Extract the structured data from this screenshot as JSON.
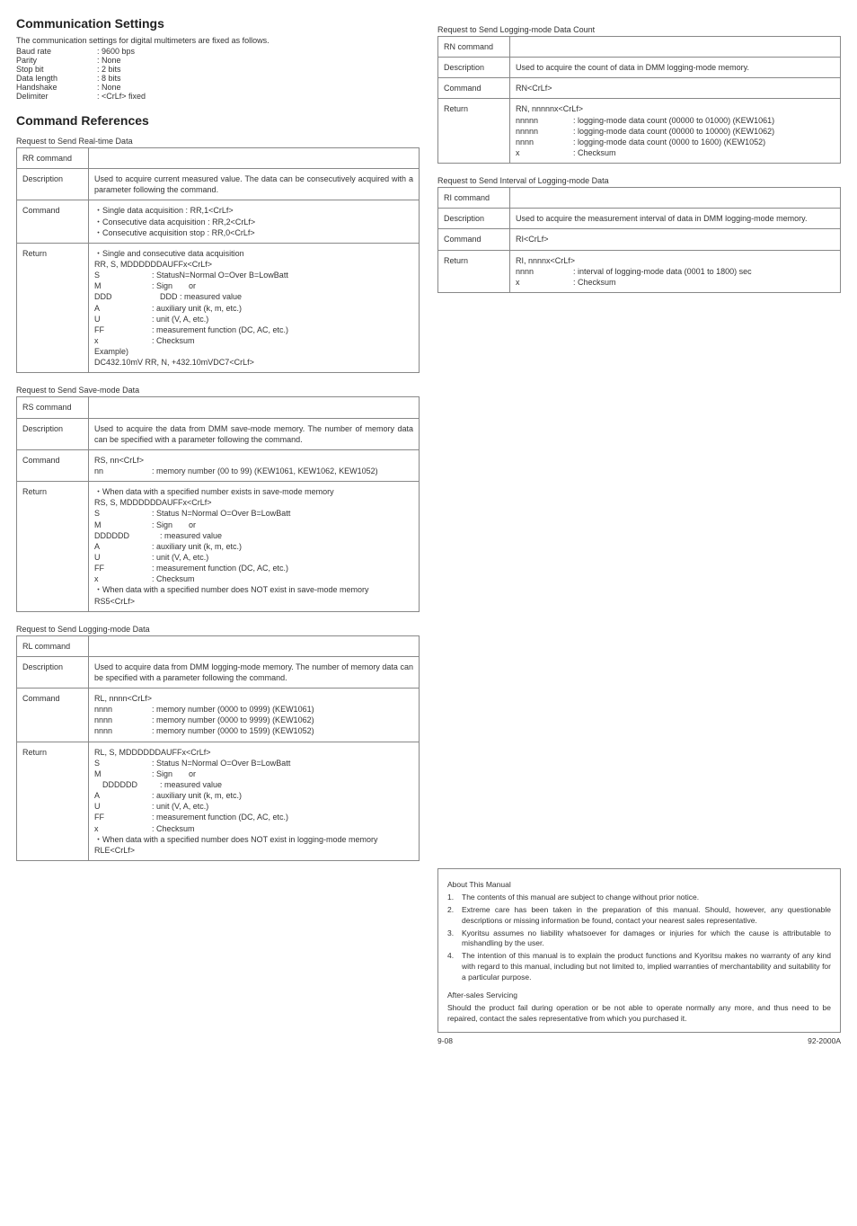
{
  "left": {
    "commSettings": {
      "heading": "Communication Settings",
      "intro": "The communication settings for digital multimeters are fixed as follows.",
      "rows": [
        {
          "k": "Baud rate",
          "v": ": 9600 bps"
        },
        {
          "k": "Parity",
          "v": ": None"
        },
        {
          "k": "Stop bit",
          "v": ": 2 bits"
        },
        {
          "k": "Data length",
          "v": ": 8 bits"
        },
        {
          "k": "Handshake",
          "v": ": None"
        },
        {
          "k": "Delimiter",
          "v": ": <CrLf> fixed"
        }
      ]
    },
    "commandRefs": {
      "heading": "Command References",
      "tables": [
        {
          "title": "Request to Send Real-time Data",
          "cmdName": "RR command",
          "rows": [
            {
              "label": "Description",
              "lines": [
                "Used to acquire current measured value. The data can be consecutively acquired with a parameter following the command."
              ],
              "justify": true
            },
            {
              "label": "Command",
              "lines": [
                "・Single data acquisition : RR,1<CrLf>",
                "・Consecutive data acquisition : RR,2<CrLf>",
                "・Consecutive acquisition stop : RR,0<CrLf>"
              ]
            },
            {
              "label": "Return",
              "lines": [
                "・Single and consecutive data acquisition",
                "RR, S, MDDDDDDAUFFx<CrLf>"
              ],
              "defs": [
                {
                  "k": "S",
                  "v": ": StatusN=Normal O=Over B=LowBatt"
                },
                {
                  "k": "M",
                  "v": ": Sign　　or"
                },
                {
                  "k": "DDD",
                  "v": "　DDD : measured value"
                },
                {
                  "k": "A",
                  "v": ": auxiliary unit (k, m, etc.)"
                },
                {
                  "k": "U",
                  "v": ": unit (V, A, etc.)"
                },
                {
                  "k": "FF",
                  "v": ": measurement function (DC, AC, etc.)"
                },
                {
                  "k": "x",
                  "v": ": Checksum"
                }
              ],
              "tail": [
                "Example)",
                "DC432.10mV  RR, N, +432.10mVDC7<CrLf>"
              ]
            }
          ]
        },
        {
          "title": "Request to Send Save-mode Data",
          "cmdName": "RS command",
          "rows": [
            {
              "label": "Description",
              "lines": [
                "Used to acquire the data from DMM save-mode memory. The number of memory data can be specified with a parameter following the command."
              ],
              "justify": true
            },
            {
              "label": "Command",
              "lines": [
                "RS, nn<CrLf>"
              ],
              "defs": [
                {
                  "k": "nn",
                  "v": ": memory number (00 to 99) (KEW1061, KEW1062, KEW1052)"
                }
              ]
            },
            {
              "label": "Return",
              "lines": [
                "・When data with a specified number exists in save-mode memory",
                "RS, S, MDDDDDDAUFFx<CrLf>"
              ],
              "defs": [
                {
                  "k": "S",
                  "v": ": Status N=Normal O=Over B=LowBatt"
                },
                {
                  "k": "M",
                  "v": ": Sign　　or"
                },
                {
                  "k": "DDDDDD",
                  "v": "　: measured value"
                },
                {
                  "k": "A",
                  "v": ": auxiliary unit (k, m, etc.)"
                },
                {
                  "k": "U",
                  "v": ": unit (V,  A, etc.)"
                },
                {
                  "k": "FF",
                  "v": ": measurement function (DC, AC, etc.)"
                },
                {
                  "k": "x",
                  "v": ": Checksum"
                }
              ],
              "tail": [
                "・When data with a specified number does NOT exist in save-mode memory",
                "RS5<CrLf>"
              ]
            }
          ]
        },
        {
          "title": "Request to Send Logging-mode Data",
          "cmdName": "RL command",
          "rows": [
            {
              "label": "Description",
              "lines": [
                "Used to acquire data from DMM logging-mode memory. The number of memory data can be specified with a parameter following the command."
              ],
              "justify": true
            },
            {
              "label": "Command",
              "lines": [
                "RL, nnnn<CrLf>"
              ],
              "defs": [
                {
                  "k": "nnnn",
                  "v": ": memory number (0000 to 0999) (KEW1061)"
                },
                {
                  "k": "nnnn",
                  "v": ": memory number (0000 to 9999) (KEW1062)"
                },
                {
                  "k": "nnnn",
                  "v": ": memory number (0000 to 1599) (KEW1052)"
                }
              ]
            },
            {
              "label": "Return",
              "lines": [
                "RL, S, MDDDDDDAUFFx<CrLf>"
              ],
              "defs": [
                {
                  "k": "S",
                  "v": ": Status N=Normal O=Over B=LowBatt"
                },
                {
                  "k": "M",
                  "v": ": Sign　　or"
                },
                {
                  "k": "　DDDDDD",
                  "v": "　: measured value"
                },
                {
                  "k": "A",
                  "v": ": auxiliary unit (k, m, etc.)"
                },
                {
                  "k": "U",
                  "v": ": unit (V, A, etc.)"
                },
                {
                  "k": "FF",
                  "v": ": measurement function (DC, AC, etc.)"
                },
                {
                  "k": "x",
                  "v": ": Checksum"
                }
              ],
              "tail": [
                "・When data with a specified number does NOT exist in logging-mode memory",
                "RLE<CrLf>"
              ]
            }
          ]
        }
      ]
    }
  },
  "right": {
    "tables": [
      {
        "title": "Request to Send Logging-mode Data Count",
        "cmdName": "RN command",
        "rows": [
          {
            "label": "Description",
            "lines": [
              "Used to acquire the count of data in DMM logging-mode memory."
            ]
          },
          {
            "label": "Command",
            "lines": [
              "RN<CrLf>"
            ]
          },
          {
            "label": "Return",
            "lines": [
              "RN, nnnnnx<CrLf>"
            ],
            "defs": [
              {
                "k": "nnnnn",
                "v": ": logging-mode data count  (00000 to 01000) (KEW1061)"
              },
              {
                "k": "nnnnn",
                "v": ": logging-mode data count  (00000 to 10000) (KEW1062)"
              },
              {
                "k": "nnnn",
                "v": ": logging-mode data count  (0000 to 1600) (KEW1052)"
              },
              {
                "k": "x",
                "v": ": Checksum"
              }
            ]
          }
        ]
      },
      {
        "title": "Request to Send Interval of Logging-mode Data",
        "cmdName": "RI command",
        "rows": [
          {
            "label": "Description",
            "lines": [
              "Used to acquire the measurement interval of data in DMM logging-mode memory."
            ],
            "justify": true
          },
          {
            "label": "Command",
            "lines": [
              "RI<CrLf>"
            ]
          },
          {
            "label": "Return",
            "lines": [
              "RI, nnnnx<CrLf>"
            ],
            "defs": [
              {
                "k": "nnnn",
                "v": ": interval of logging-mode data (0001 to 1800) sec"
              },
              {
                "k": "x",
                "v": ": Checksum"
              }
            ]
          }
        ]
      }
    ],
    "about": {
      "title1": "About This Manual",
      "items": [
        "The contents of this manual are subject to change without prior notice.",
        "Extreme care has been taken in the preparation of this manual. Should, however, any questionable descriptions or missing information be found, contact your nearest sales representative.",
        "Kyoritsu assumes no liability whatsoever for damages or injuries for which the cause is attributable to mishandling by the user.",
        "The intention of this manual is to explain the product functions and Kyoritsu makes no warranty of any kind with regard to this manual, including but not limited to, implied warranties of merchantability and suitability for a particular purpose."
      ],
      "title2": "After-sales Servicing",
      "para": "Should the product fail during operation or be not able to operate normally any more, and thus need to be repaired, contact the sales representative from which you purchased it."
    },
    "footer": {
      "left": "9-08",
      "right": "92-2000A"
    }
  }
}
